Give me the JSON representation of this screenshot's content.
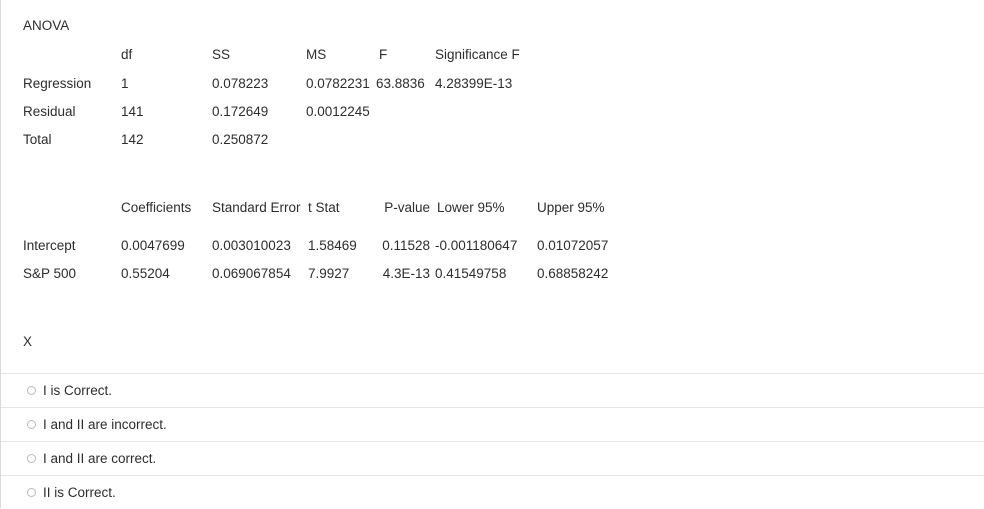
{
  "anova": {
    "title": "ANOVA",
    "headers": [
      "df",
      "SS",
      "MS",
      "F",
      "Significance F"
    ],
    "rows": [
      {
        "label": "Regression",
        "df": "1",
        "ss": "0.078223",
        "ms": "0.0782231",
        "f": "63.8836",
        "significance_f": "4.28399E-13"
      },
      {
        "label": "Residual",
        "df": "141",
        "ss": "0.172649",
        "ms": "0.0012245",
        "f": "",
        "significance_f": ""
      },
      {
        "label": "Total",
        "df": "142",
        "ss": "0.250872",
        "ms": "",
        "f": "",
        "significance_f": ""
      }
    ]
  },
  "coefficients": {
    "headers": [
      "Coefficients",
      "Standard Error",
      "t Stat",
      "P-value",
      "Lower 95%",
      "Upper 95%"
    ],
    "rows": [
      {
        "label": "Intercept",
        "coefficient": "0.0047699",
        "standard_error": "0.003010023",
        "t_stat": "1.58469",
        "p_value": "0.11528",
        "lower_95": "-0.001180647",
        "upper_95": "0.01072057"
      },
      {
        "label": "S&P 500",
        "coefficient": "0.55204",
        "standard_error": "0.069067854",
        "t_stat": "7.9927",
        "p_value": "4.3E-13",
        "lower_95": "0.41549758",
        "upper_95": "0.68858242"
      }
    ]
  },
  "question": {
    "label": "X"
  },
  "options": [
    {
      "label": "I is Correct.",
      "selected": false
    },
    {
      "label": "I and II are incorrect.",
      "selected": false
    },
    {
      "label": "I and II are correct.",
      "selected": false
    },
    {
      "label": "II is Correct.",
      "selected": false
    }
  ],
  "colors": {
    "text": "#2d2d2d",
    "background": "#ffffff",
    "divider": "#e6e6e8",
    "left_border": "#d9d9dd",
    "radio_border": "#b9b9bf"
  }
}
